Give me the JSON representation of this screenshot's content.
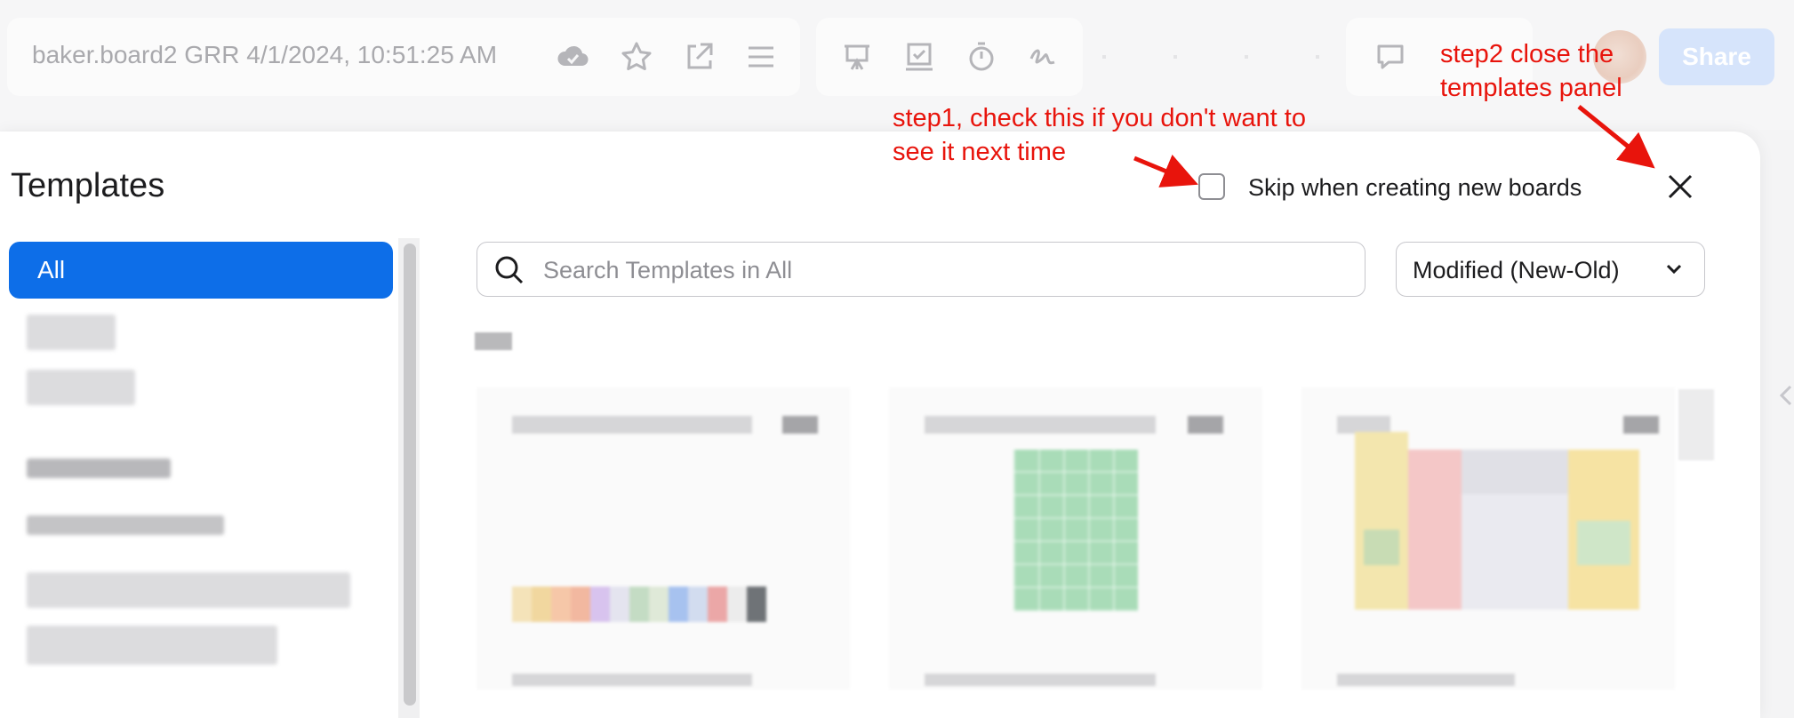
{
  "topbar": {
    "board_title": "baker.board2 GRR 4/1/2024, 10:51:25 AM",
    "share_label": "Share",
    "icons": [
      "cloud-check-icon",
      "star-icon",
      "open-external-icon",
      "menu-icon",
      "presentation-icon",
      "checklist-icon",
      "timer-icon",
      "signature-icon",
      "comment-icon",
      "avatar"
    ]
  },
  "modal": {
    "title": "Templates",
    "skip_label": "Skip when creating new boards",
    "skip_checked": false,
    "close_icon": "close-icon"
  },
  "sidebar": {
    "selected_label": "All"
  },
  "search": {
    "placeholder": "Search Templates in All",
    "value": ""
  },
  "sort": {
    "selected": "Modified (New-Old)"
  },
  "annotations": {
    "step1_line1": "step1, check this if you don't want to",
    "step1_line2": "see it next time",
    "step2_line1": "step2 close the",
    "step2_line2": "templates panel"
  },
  "colors": {
    "accent": "#0d6ee8",
    "annotation": "#e8140c",
    "share_button": "#d6e4fb"
  }
}
